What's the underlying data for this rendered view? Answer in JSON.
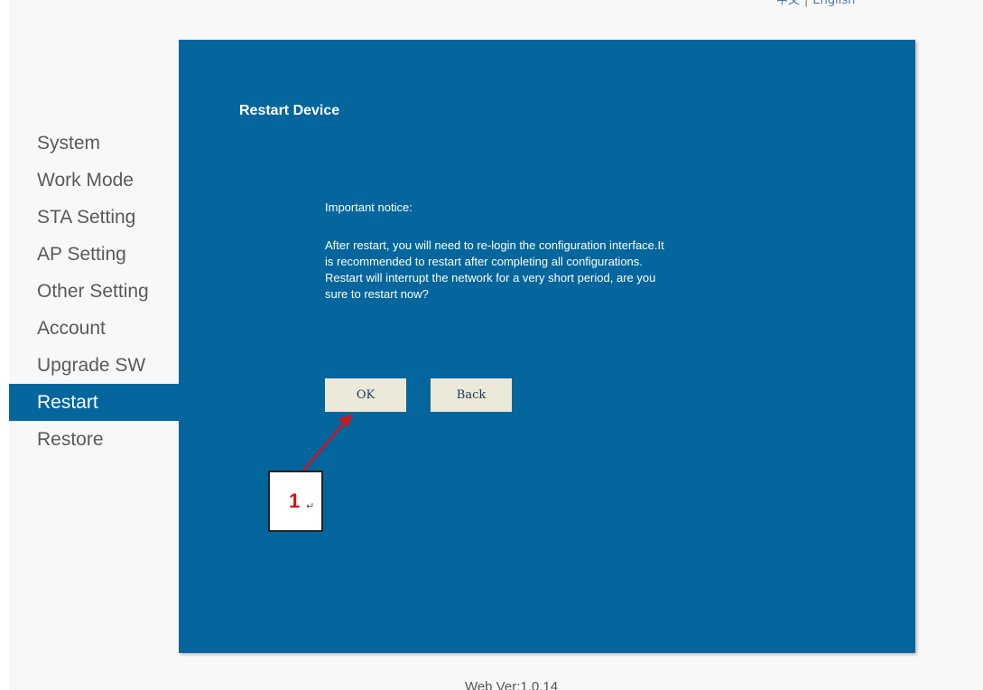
{
  "language_bar": {
    "chinese_label": "中文",
    "separator": "|",
    "english_label": "English"
  },
  "sidebar": {
    "items": [
      {
        "label": "System"
      },
      {
        "label": "Work Mode"
      },
      {
        "label": "STA Setting"
      },
      {
        "label": "AP Setting"
      },
      {
        "label": "Other Setting"
      },
      {
        "label": "Account"
      },
      {
        "label": "Upgrade SW"
      },
      {
        "label": "Restart",
        "active": true
      },
      {
        "label": "Restore"
      }
    ]
  },
  "main": {
    "title": "Restart Device",
    "notice_heading": "Important notice:",
    "notice_lines": [
      "After restart, you will need to re-login the configuration interface.It",
      "is recommended to restart after completing all configurations.",
      "Restart will interrupt the network for a very short period, are you",
      "sure to restart now?"
    ],
    "ok_label": "OK",
    "back_label": "Back"
  },
  "annotation": {
    "number": "1",
    "return_symbol": "↵"
  },
  "footer": {
    "version": "Web Ver:1.0.14"
  },
  "colors": {
    "panel": "#04669d",
    "button": "#ece9d8",
    "arrow": "#d0141a"
  }
}
